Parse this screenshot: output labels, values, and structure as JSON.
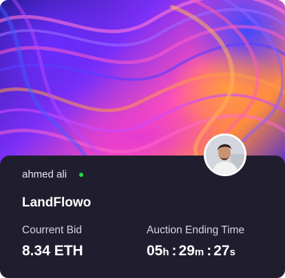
{
  "card": {
    "creator_name": "ahmed ali",
    "online_color": "#29d64a",
    "title": "LandFlowo",
    "bid": {
      "label": "Courrent Bid",
      "value": "8.34 ETH"
    },
    "auction": {
      "label": "Auction Ending Time",
      "hours": "05",
      "hours_unit": "h",
      "minutes": "29",
      "minutes_unit": "m",
      "seconds": "27",
      "seconds_unit": "s",
      "separator": ":"
    }
  },
  "colors": {
    "panel_background": "#201e2e",
    "text_primary": "#ffffff",
    "text_secondary": "#d6d5de"
  },
  "icons": {
    "artwork": "abstract-swirl-artwork",
    "avatar": "user-avatar-photo"
  }
}
